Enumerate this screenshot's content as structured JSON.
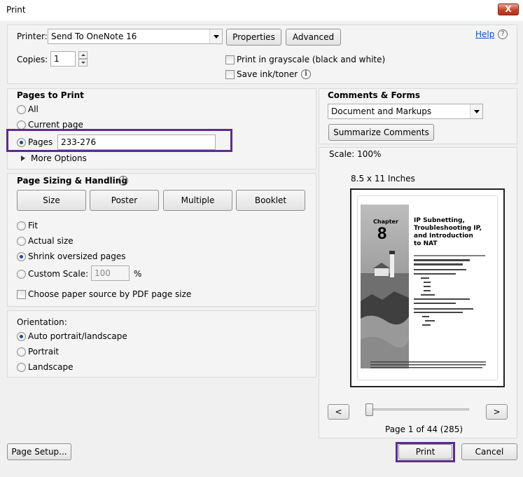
{
  "window": {
    "title": "Print",
    "close_label": "X"
  },
  "printer": {
    "label": "Printer:",
    "selected": "Send To OneNote 16",
    "properties_label": "Properties",
    "advanced_label": "Advanced",
    "help_label": "Help",
    "copies_label": "Copies:",
    "copies_value": "1",
    "grayscale_label": "Print in grayscale (black and white)",
    "save_ink_label": "Save ink/toner"
  },
  "pages_to_print": {
    "heading": "Pages to Print",
    "all_label": "All",
    "current_label": "Current page",
    "pages_label": "Pages",
    "pages_value": "233-276",
    "more_options_label": "More Options"
  },
  "sizing": {
    "heading": "Page Sizing & Handling",
    "tabs": [
      "Size",
      "Poster",
      "Multiple",
      "Booklet"
    ],
    "fit_label": "Fit",
    "actual_label": "Actual size",
    "shrink_label": "Shrink oversized pages",
    "custom_label": "Custom Scale:",
    "custom_value": "100",
    "percent": "%",
    "paper_source_label": "Choose paper source by PDF page size"
  },
  "orientation": {
    "heading": "Orientation:",
    "auto_label": "Auto portrait/landscape",
    "portrait_label": "Portrait",
    "landscape_label": "Landscape"
  },
  "comments": {
    "heading": "Comments & Forms",
    "selected": "Document and Markups",
    "summarize_label": "Summarize Comments"
  },
  "preview": {
    "scale_text": "Scale: 100%",
    "paper_size": "8.5 x 11 Inches",
    "page_info": "Page 1 of 44 (285)",
    "prev_label": "<",
    "next_label": ">",
    "page_content": {
      "chapter_word": "Chapter",
      "chapter_number": "8",
      "title_lines": [
        "IP Subnetting,",
        "Troubleshooting IP,",
        "and Introduction",
        "to NAT"
      ]
    }
  },
  "footer": {
    "page_setup_label": "Page Setup...",
    "print_label": "Print",
    "cancel_label": "Cancel"
  },
  "colors": {
    "highlight": "#5b2d8e",
    "link": "#0b4fc1"
  }
}
